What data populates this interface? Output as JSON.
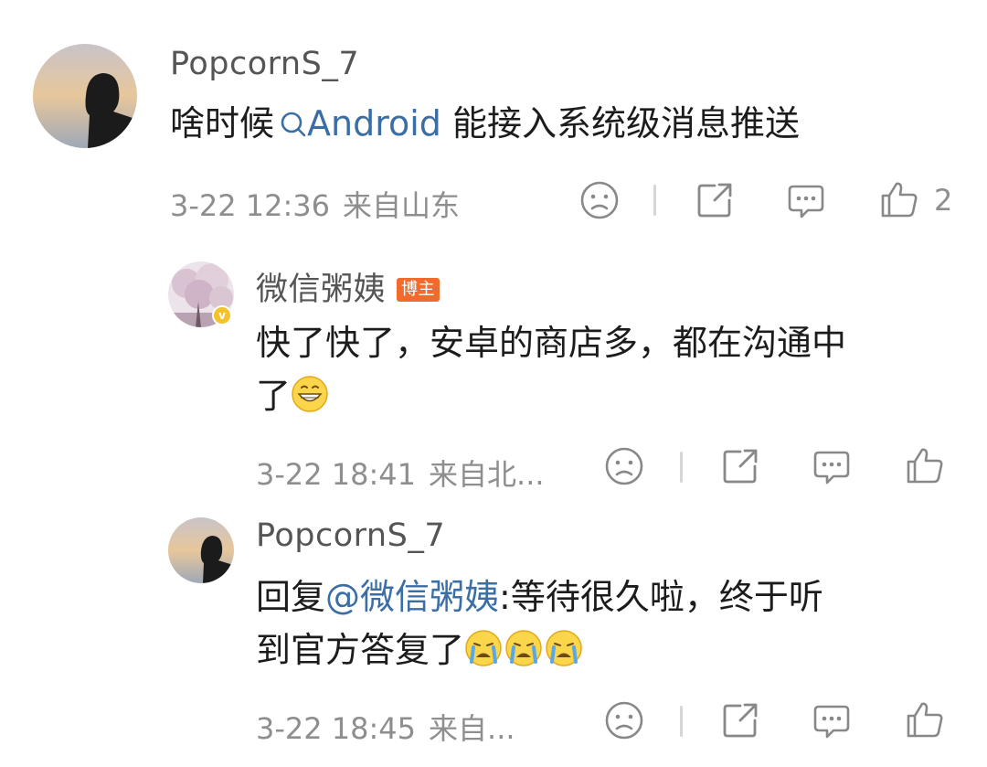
{
  "comments": [
    {
      "username": "PopcornS_7",
      "text_before": "啥时候",
      "topic_link": "Android",
      "text_after": " 能接入系统级消息推送",
      "time": "3-22 12:36",
      "location": "来自山东",
      "like_count": "2"
    },
    {
      "username": "微信粥姨",
      "author_badge": "博主",
      "line1": "快了快了，安卓的商店多，都在沟通中",
      "line2": "了",
      "time": "3-22 18:41",
      "location": "来自北...",
      "verified_badge": "v"
    },
    {
      "username": "PopcornS_7",
      "reply_prefix": "回复",
      "mention": "@微信粥姨",
      "line1_after": ":等待很久啦，终于听",
      "line2": "到官方答复了",
      "time": "3-22 18:45",
      "location": "来自..."
    }
  ],
  "icons": [
    "frown-icon",
    "share-icon",
    "comment-icon",
    "thumbs-up-icon"
  ],
  "colors": {
    "link": "#3b6ea5",
    "meta": "#8e8e8e",
    "badge": "#f26b2d"
  }
}
